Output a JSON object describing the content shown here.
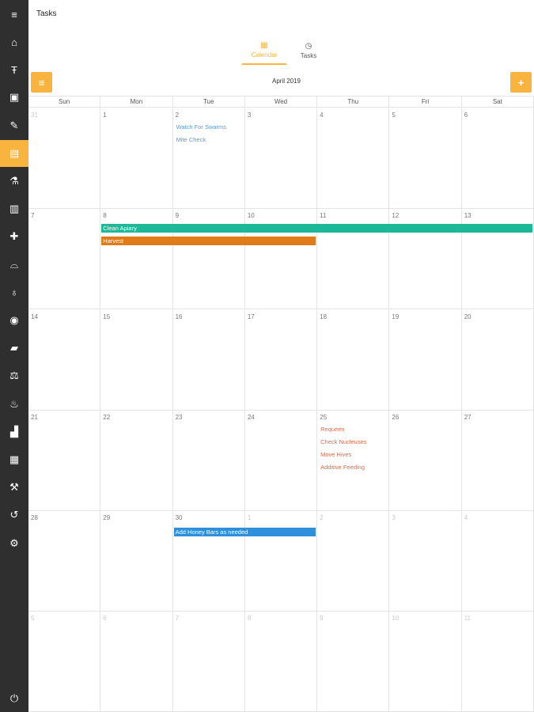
{
  "header": {
    "title": "Tasks"
  },
  "sidebar": {
    "items": [
      {
        "icon": "menu-icon",
        "glyph": "≡"
      },
      {
        "icon": "home-icon",
        "glyph": "⌂"
      },
      {
        "icon": "hive-icon",
        "glyph": "Ŧ"
      },
      {
        "icon": "inbox-icon",
        "glyph": "▣"
      },
      {
        "icon": "edit-icon",
        "glyph": "✎"
      },
      {
        "icon": "calendar-icon",
        "glyph": "▤"
      },
      {
        "icon": "flask-icon",
        "glyph": "⚗"
      },
      {
        "icon": "jar-icon",
        "glyph": "▥"
      },
      {
        "icon": "medkit-icon",
        "glyph": "✚"
      },
      {
        "icon": "hat-icon",
        "glyph": "⌓"
      },
      {
        "icon": "money-bag-icon",
        "glyph": "♁"
      },
      {
        "icon": "globe-icon",
        "glyph": "◉"
      },
      {
        "icon": "truck-icon",
        "glyph": "▰"
      },
      {
        "icon": "scale-icon",
        "glyph": "⚖"
      },
      {
        "icon": "basket-icon",
        "glyph": "♨"
      },
      {
        "icon": "chart-icon",
        "glyph": "▟"
      },
      {
        "icon": "calculator-icon",
        "glyph": "▦"
      },
      {
        "icon": "magic-wand-icon",
        "glyph": "⚒"
      },
      {
        "icon": "history-icon",
        "glyph": "↺"
      },
      {
        "icon": "settings-icon",
        "glyph": "⚙"
      }
    ],
    "logout_icon": "power-icon",
    "logout_glyph": "⏻"
  },
  "tabs": [
    {
      "label": "Calendar",
      "icon": "calendar-small-icon",
      "glyph": "▦",
      "active": true
    },
    {
      "label": "Tasks",
      "icon": "clock-icon",
      "glyph": "◷",
      "active": false
    }
  ],
  "toolbar": {
    "menu_glyph": "≡",
    "add_glyph": "+",
    "month_title": "April 2019"
  },
  "days_of_week": [
    "Sun",
    "Mon",
    "Tue",
    "Wed",
    "Thu",
    "Fri",
    "Sat"
  ],
  "weeks": [
    [
      "31",
      "1",
      "2",
      "3",
      "4",
      "5",
      "6"
    ],
    [
      "7",
      "8",
      "9",
      "10",
      "11",
      "12",
      "13"
    ],
    [
      "14",
      "15",
      "16",
      "17",
      "18",
      "19",
      "20"
    ],
    [
      "21",
      "22",
      "23",
      "24",
      "25",
      "26",
      "27"
    ],
    [
      "28",
      "29",
      "30",
      "1",
      "2",
      "3",
      "4"
    ],
    [
      "5",
      "6",
      "7",
      "8",
      "9",
      "10",
      "11"
    ]
  ],
  "cell_events": {
    "w0d2": [
      "Watch For Swarms",
      "Mite Check"
    ],
    "w3d4": [
      "Requeen",
      "Check Nucleuses",
      "Move Hives",
      "Additive Feeding"
    ]
  },
  "bars": [
    {
      "label": "Clean Apiary",
      "color": "#1db897"
    },
    {
      "label": "Harvest",
      "color": "#e07b17"
    },
    {
      "label": "Add Honey Bars as needed",
      "color": "#2e8fdc"
    }
  ],
  "colors": {
    "accent": "#f9b440",
    "sidebar": "#2f2f2f"
  }
}
